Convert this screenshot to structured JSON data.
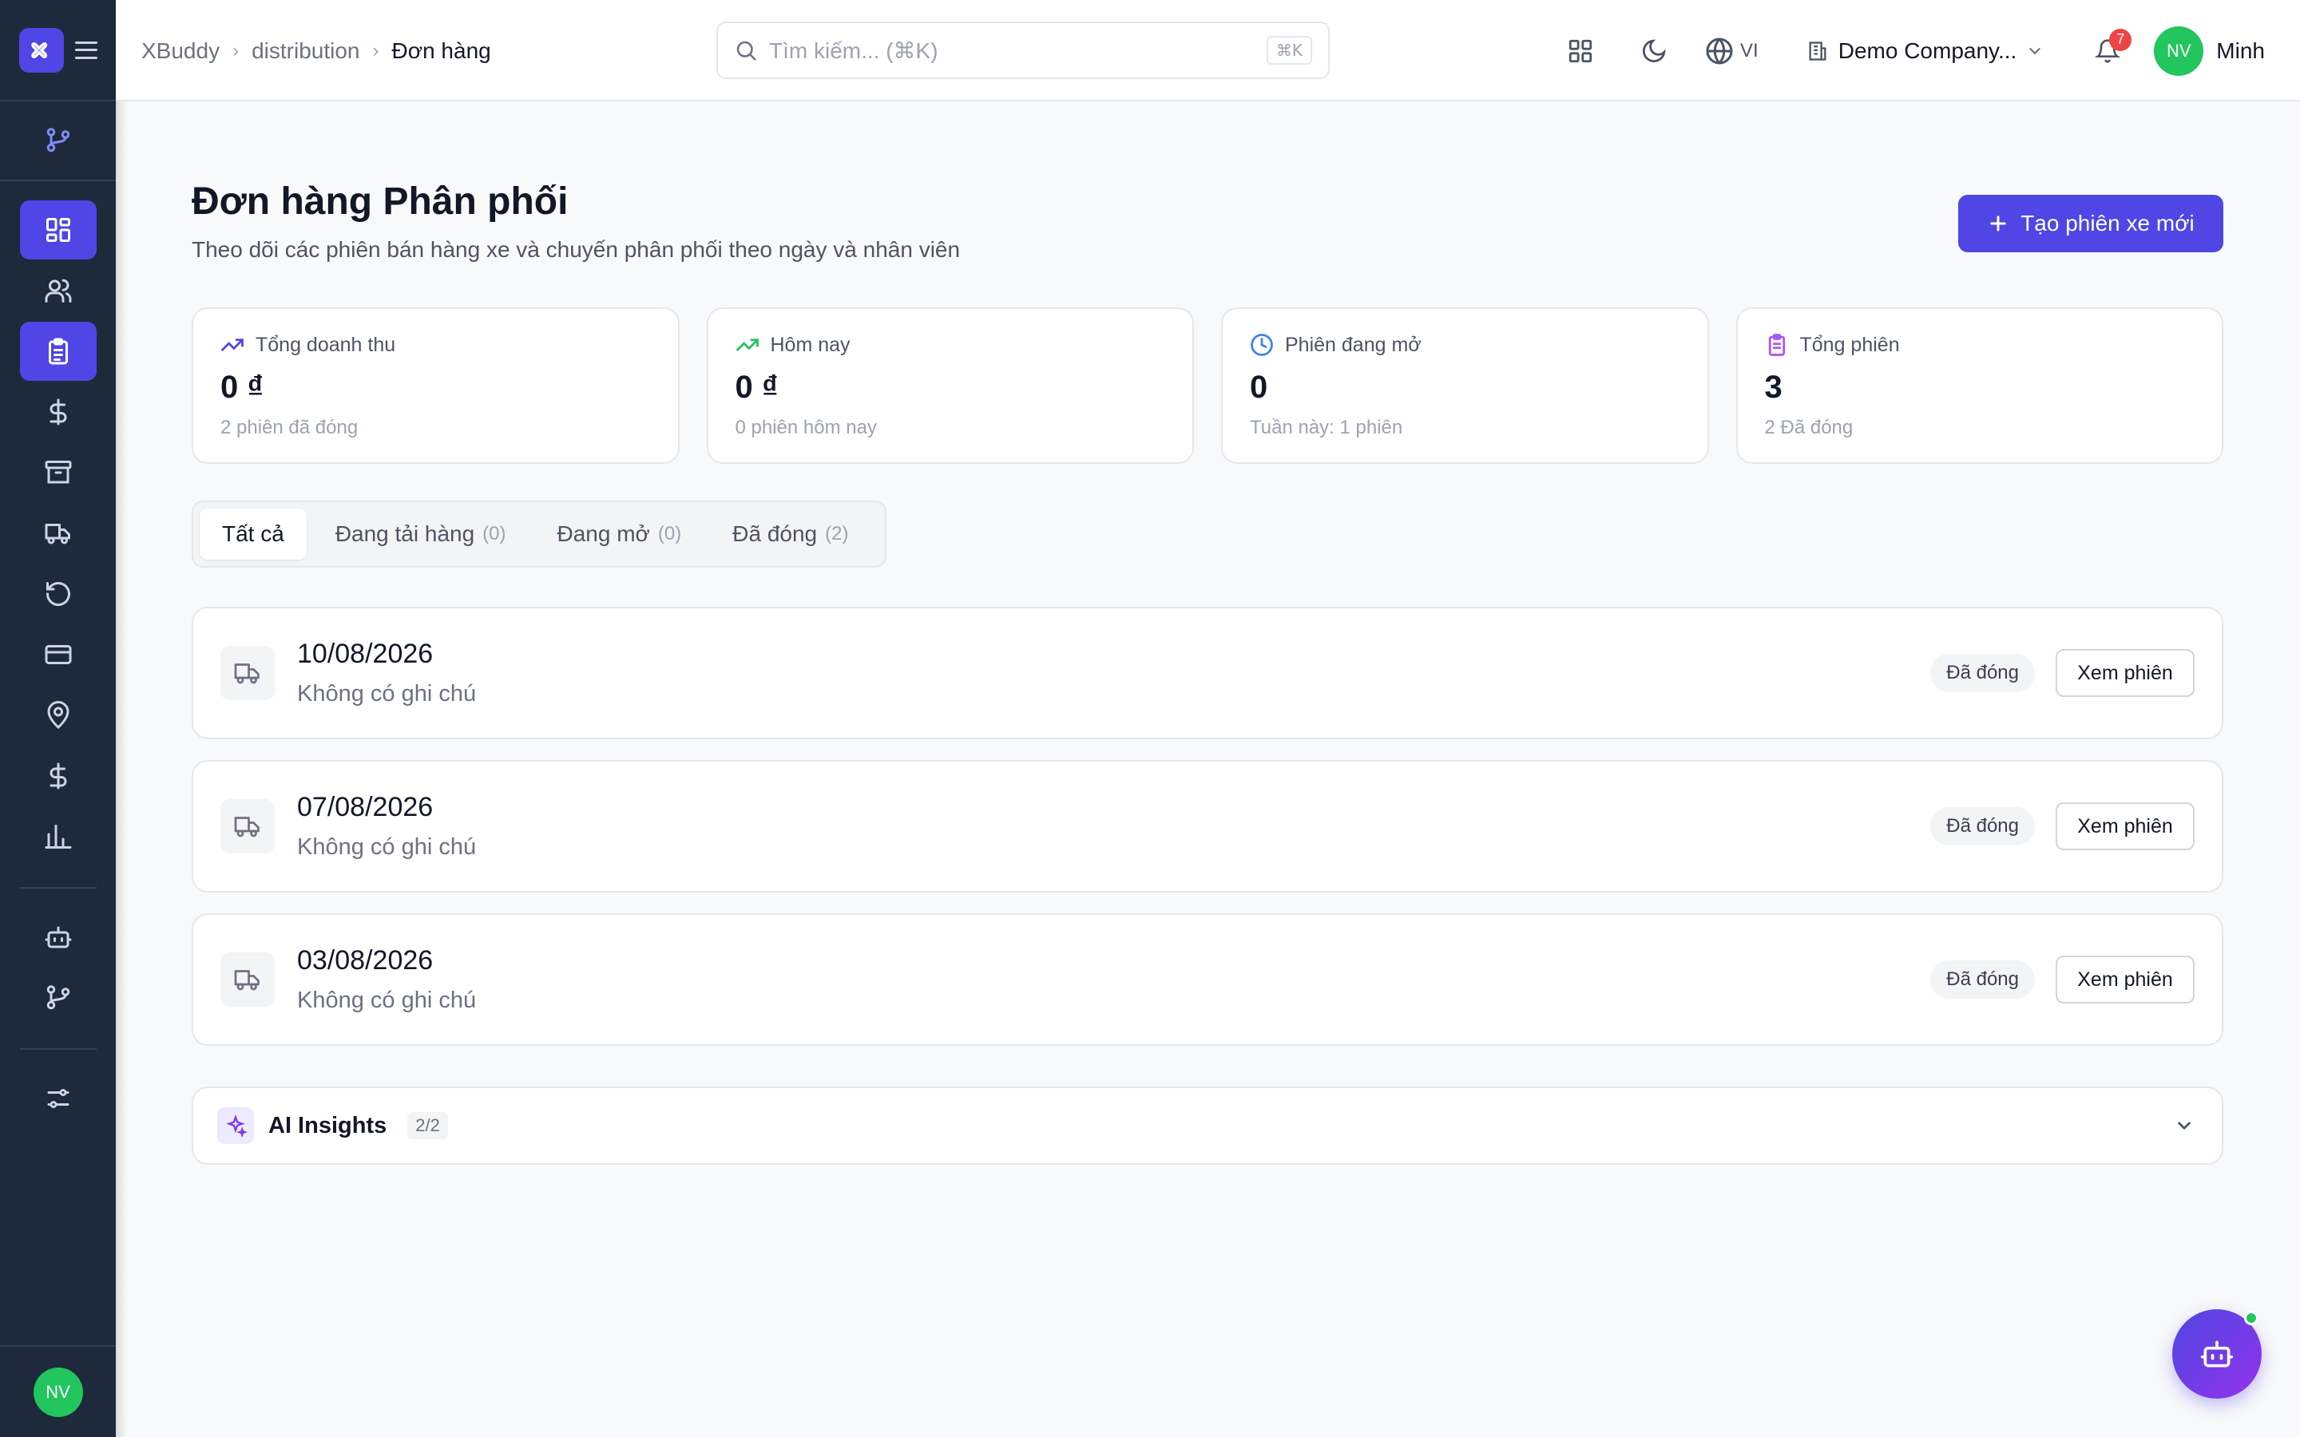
{
  "breadcrumb": {
    "items": [
      "XBuddy",
      "distribution",
      "Đơn hàng"
    ]
  },
  "search": {
    "placeholder": "Tìm kiếm... (⌘K)",
    "shortcut": "⌘K"
  },
  "header": {
    "language": "VI",
    "company": "Demo Company...",
    "notification_count": "7",
    "user_initials": "NV",
    "user_name": "Minh"
  },
  "sidebar": {
    "avatar_initials": "NV",
    "items": [
      {
        "icon": "dashboard-icon",
        "active": true
      },
      {
        "icon": "users-icon",
        "active": false
      },
      {
        "icon": "clipboard-icon",
        "active": true
      },
      {
        "icon": "dollar-icon",
        "active": false
      },
      {
        "icon": "archive-icon",
        "active": false
      },
      {
        "icon": "truck-icon",
        "active": false
      },
      {
        "icon": "refresh-icon",
        "active": false
      },
      {
        "icon": "credit-card-icon",
        "active": false
      },
      {
        "icon": "map-pin-icon",
        "active": false
      },
      {
        "icon": "dollar-icon",
        "active": false
      },
      {
        "icon": "bar-chart-icon",
        "active": false
      }
    ]
  },
  "page": {
    "title": "Đơn hàng Phân phối",
    "subtitle": "Theo dõi các phiên bán hàng xe và chuyến phân phối theo ngày và nhân viên",
    "create_button": "Tạo phiên xe mới"
  },
  "stats": [
    {
      "label": "Tổng doanh thu",
      "value": "0 ₫",
      "sub": "2 phiên đã đóng",
      "color": "#4f46e5"
    },
    {
      "label": "Hôm nay",
      "value": "0 ₫",
      "sub": "0 phiên hôm nay",
      "color": "#22c55e"
    },
    {
      "label": "Phiên đang mở",
      "value": "0",
      "sub": "Tuần này: 1 phiên",
      "color": "#3b82f6"
    },
    {
      "label": "Tổng phiên",
      "value": "3",
      "sub": "2 Đã đóng",
      "color": "#a855f7"
    }
  ],
  "tabs": [
    {
      "label": "Tất cả",
      "count": ""
    },
    {
      "label": "Đang tải hàng",
      "count": "(0)"
    },
    {
      "label": "Đang mở",
      "count": "(0)"
    },
    {
      "label": "Đã đóng",
      "count": "(2)"
    }
  ],
  "sessions": [
    {
      "date": "10/08/2026",
      "note": "Không có ghi chú",
      "status": "Đã đóng",
      "action": "Xem phiên"
    },
    {
      "date": "07/08/2026",
      "note": "Không có ghi chú",
      "status": "Đã đóng",
      "action": "Xem phiên"
    },
    {
      "date": "03/08/2026",
      "note": "Không có ghi chú",
      "status": "Đã đóng",
      "action": "Xem phiên"
    }
  ],
  "ai_insights": {
    "title": "AI Insights",
    "count": "2/2"
  },
  "colors": {
    "accent": "#4f46e5",
    "sidebar_bg": "#1e293b",
    "success": "#22c55e",
    "danger": "#ef4444"
  }
}
